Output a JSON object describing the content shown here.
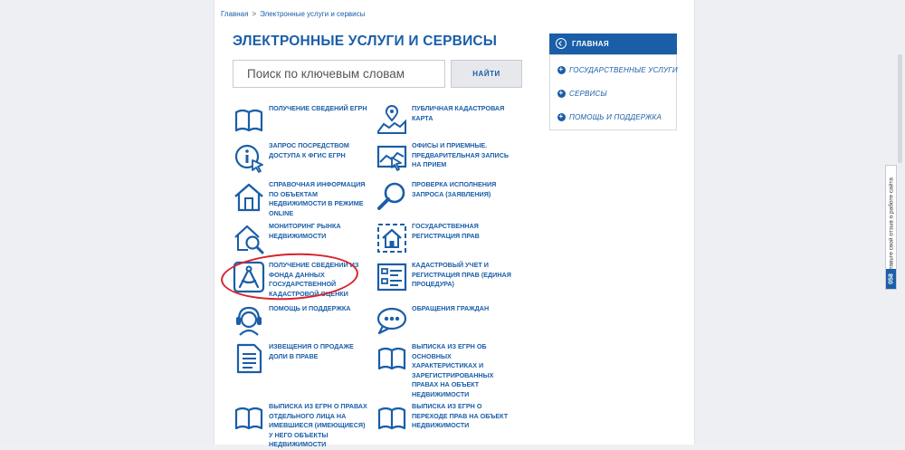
{
  "breadcrumb": {
    "home": "Главная",
    "separator": ">",
    "current": "Электронные услуги и сервисы"
  },
  "page_title": "ЭЛЕКТРОННЫЕ УСЛУГИ И СЕРВИСЫ",
  "search": {
    "placeholder": "Поиск по ключевым словам",
    "button_label": "НАЙТИ"
  },
  "services": [
    {
      "label": "ПОЛУЧЕНИЕ СВЕДЕНИЙ ЕГРН",
      "icon": "book-icon"
    },
    {
      "label": "ПУБЛИЧНАЯ КАДАСТРОВАЯ КАРТА",
      "icon": "map-pin-icon"
    },
    {
      "label": "ЗАПРОС ПОСРЕДСТВОМ ДОСТУПА К ФГИС ЕГРН",
      "icon": "info-cursor-icon"
    },
    {
      "label": "ОФИСЫ И ПРИЕМНЫЕ. ПРЕДВАРИТЕЛЬНАЯ ЗАПИСЬ НА ПРИЕМ",
      "icon": "map-cursor-icon"
    },
    {
      "label": "СПРАВОЧНАЯ ИНФОРМАЦИЯ ПО ОБЪЕКТАМ НЕДВИЖИМОСТИ В РЕЖИМЕ ONLINE",
      "icon": "house-icon"
    },
    {
      "label": "ПРОВЕРКА ИСПОЛНЕНИЯ ЗАПРОСА (ЗАЯВЛЕНИЯ)",
      "icon": "magnifier-icon"
    },
    {
      "label": "МОНИТОРИНГ РЫНКА НЕДВИЖИМОСТИ",
      "icon": "house-search-icon"
    },
    {
      "label": "ГОСУДАРСТВЕННАЯ РЕГИСТРАЦИЯ ПРАВ",
      "icon": "house-frame-icon"
    },
    {
      "label": "ПОЛУЧЕНИЕ СВЕДЕНИЙ ИЗ ФОНДА ДАННЫХ ГОСУДАРСТВЕННОЙ КАДАСТРОВОЙ ОЦЕНКИ",
      "icon": "compass-icon"
    },
    {
      "label": "КАДАСТРОВЫЙ УЧЕТ И РЕГИСТРАЦИЯ ПРАВ (ЕДИНАЯ ПРОЦЕДУРА)",
      "icon": "checklist-icon"
    },
    {
      "label": "ПОМОЩЬ И ПОДДЕРЖКА",
      "icon": "headset-icon"
    },
    {
      "label": "ОБРАЩЕНИЯ ГРАЖДАН",
      "icon": "chat-bubble-icon"
    },
    {
      "label": "ИЗВЕЩЕНИЯ О ПРОДАЖЕ ДОЛИ В ПРАВЕ",
      "icon": "document-icon"
    },
    {
      "label": "ВЫПИСКА ИЗ ЕГРН ОБ ОСНОВНЫХ ХАРАКТЕРИСТИКАХ И ЗАРЕГИСТРИРОВАННЫХ ПРАВАХ НА ОБЪЕКТ НЕДВИЖИМОСТИ",
      "icon": "book-icon"
    },
    {
      "label": "ВЫПИСКА ИЗ ЕГРН О ПРАВАХ ОТДЕЛЬНОГО ЛИЦА НА ИМЕВШИЕСЯ (ИМЕЮЩИЕСЯ) У НЕГО ОБЪЕКТЫ НЕДВИЖИМОСТИ",
      "icon": "book-icon"
    },
    {
      "label": "ВЫПИСКА ИЗ ЕГРН О ПЕРЕХОДЕ ПРАВ НА ОБЪЕКТ НЕДВИЖИМОСТИ",
      "icon": "book-icon"
    }
  ],
  "nav": {
    "main": "ГЛАВНАЯ",
    "items": [
      "ГОСУДАРСТВЕННЫЕ УСЛУГИ",
      "СЕРВИСЫ",
      "ПОМОЩЬ И ПОДДЕРЖКА"
    ]
  },
  "feedback": {
    "text": "Оставьте свой отзыв о работе сайта",
    "number": "058"
  },
  "colors": {
    "accent": "#1a5ea8",
    "highlight": "#d9222c"
  }
}
